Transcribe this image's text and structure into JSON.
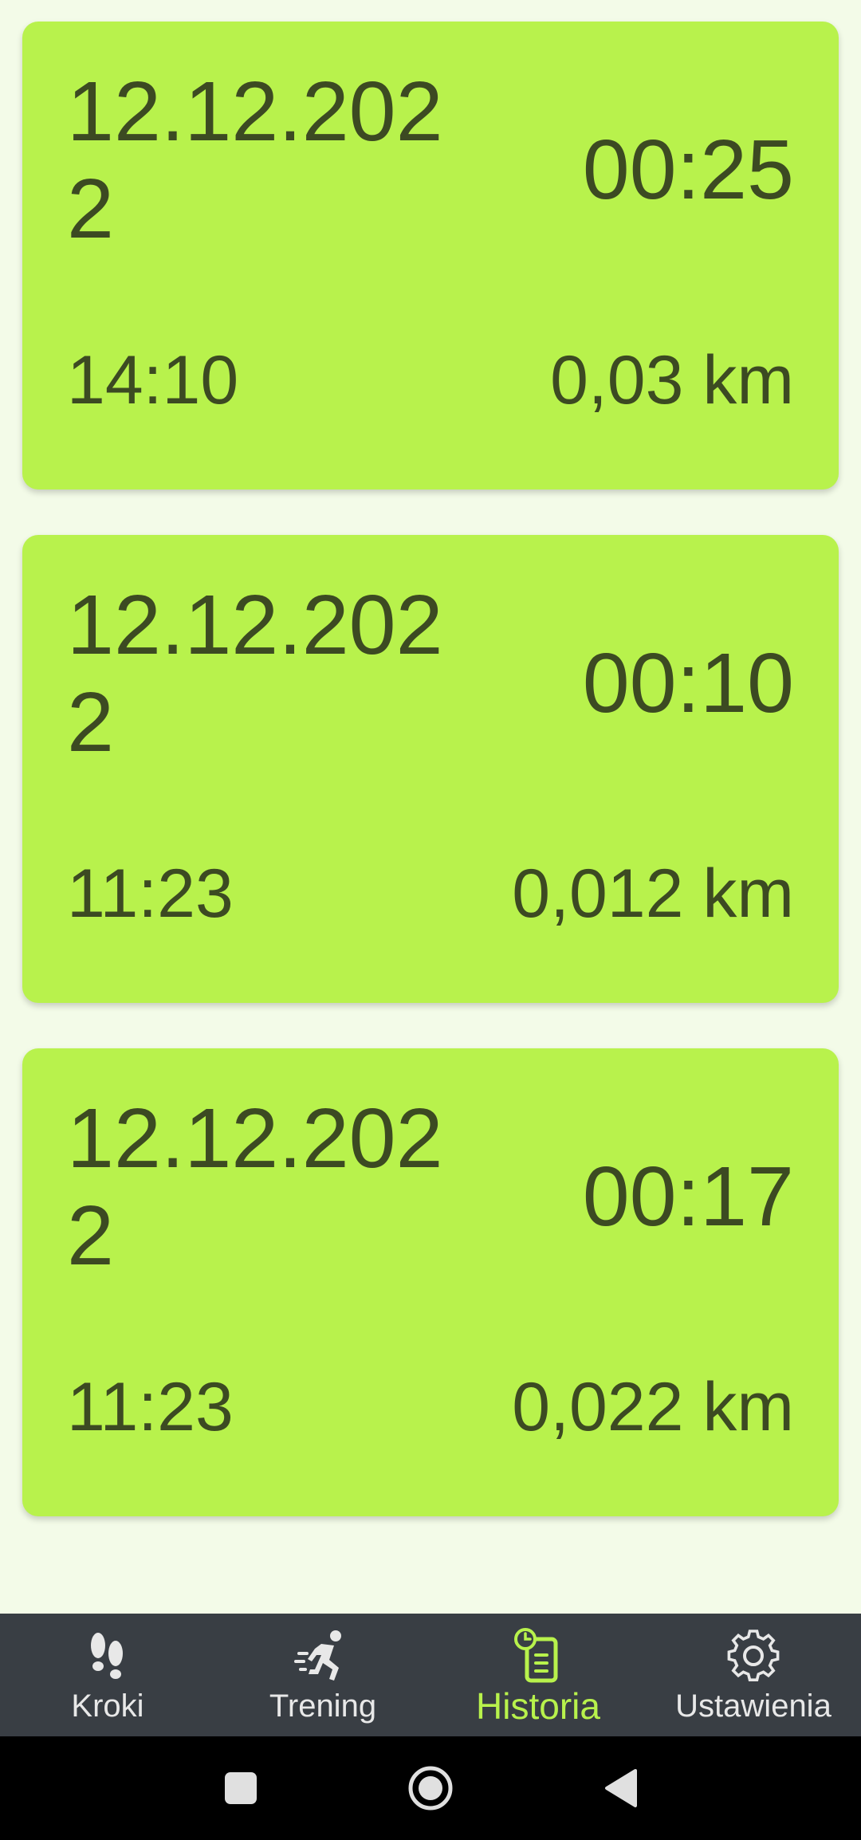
{
  "history": [
    {
      "date": "12.12.2022",
      "duration": "00:25",
      "time": "14:10",
      "distance": "0,03 km"
    },
    {
      "date": "12.12.2022",
      "duration": "00:10",
      "time": "11:23",
      "distance": "0,012 km"
    },
    {
      "date": "12.12.2022",
      "duration": "00:17",
      "time": "11:23",
      "distance": "0,022 km"
    }
  ],
  "nav": {
    "items": [
      {
        "label": "Kroki",
        "icon": "footprints-icon"
      },
      {
        "label": "Trening",
        "icon": "running-person-icon"
      },
      {
        "label": "Historia",
        "icon": "history-clipboard-icon",
        "active": true
      },
      {
        "label": "Ustawienia",
        "icon": "gear-icon"
      }
    ]
  },
  "colors": {
    "card": "#b8f24c",
    "text": "#3c4a22",
    "background": "#f3fbe8",
    "nav_bg": "#393e44",
    "active": "#b8f24c"
  }
}
